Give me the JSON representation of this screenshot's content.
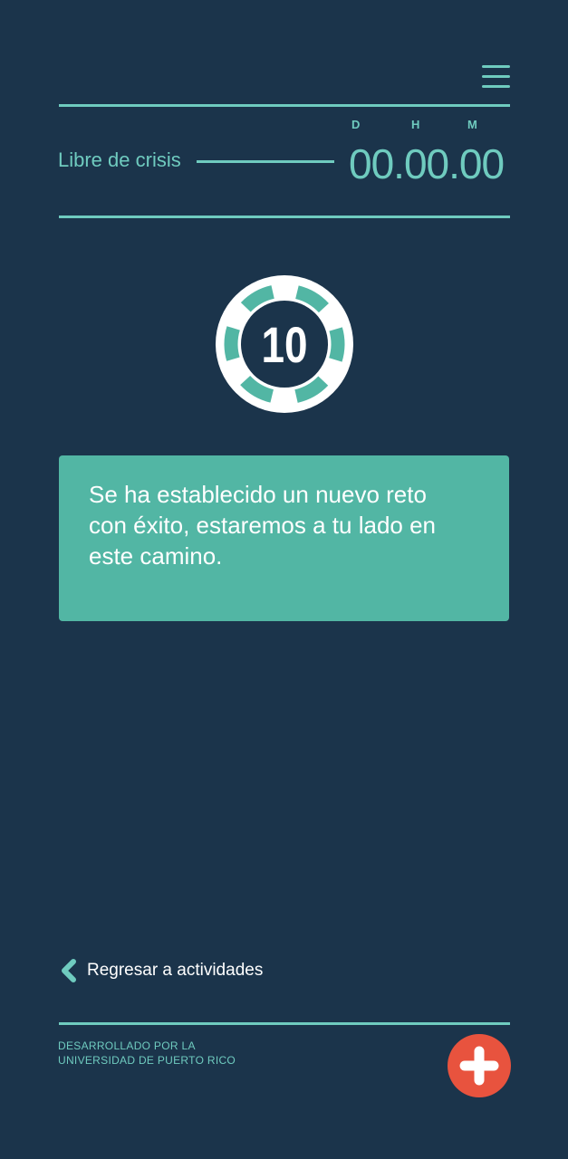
{
  "header": {
    "menu_icon": "hamburger-menu-icon"
  },
  "timer": {
    "label": "Libre de crisis",
    "units": {
      "days": "D",
      "hours": "H",
      "minutes": "M"
    },
    "value": "00.00.00"
  },
  "badge": {
    "number": "10",
    "colors": {
      "ring": "#ffffff",
      "segments": "#52b6a4",
      "center": "#1b344b"
    }
  },
  "message": {
    "text": "Se ha establecido un nuevo reto con éxito, estaremos a tu lado en este camino."
  },
  "navigation": {
    "back_label": "Regresar a actividades",
    "back_icon": "chevron-left-icon"
  },
  "footer": {
    "credit_line1": "DESARROLLADO POR LA",
    "credit_line2": "UNIVERSIDAD DE PUERTO RICO",
    "emergency_icon": "plus-icon"
  },
  "colors": {
    "background": "#1b344b",
    "accent": "#6fcbbf",
    "card": "#52b6a4",
    "emergency": "#e8533e"
  }
}
